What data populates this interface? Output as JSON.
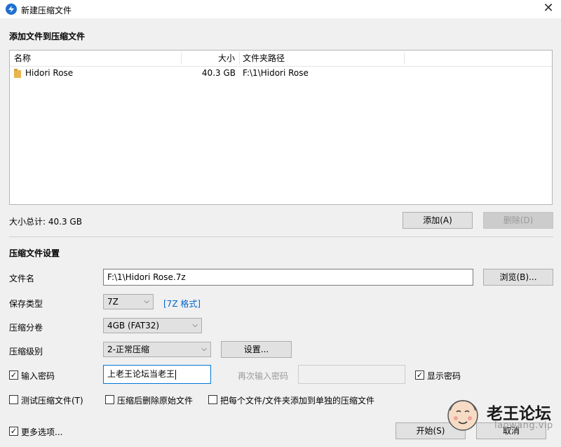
{
  "window": {
    "title": "新建压缩文件",
    "close_glyph": "✕"
  },
  "files_section": {
    "title": "添加文件到压缩文件",
    "columns": {
      "name": "名称",
      "size": "大小",
      "path": "文件夹路径"
    },
    "rows": [
      {
        "name": "Hidori Rose",
        "size": "40.3 GB",
        "path": "F:\\1\\Hidori Rose",
        "icon": "folder-icon"
      }
    ],
    "total": "大小总计: 40.3 GB",
    "add_label": "添加(A)",
    "remove_label": "删除(D)"
  },
  "settings": {
    "title": "压缩文件设置",
    "filename_label": "文件名",
    "filename_value": "F:\\1\\Hidori Rose.7z",
    "browse_label": "浏览(B)...",
    "type_label": "保存类型",
    "type_value": "7Z",
    "type_link": "[7Z 格式]",
    "split_label": "压缩分卷",
    "split_value": "4GB (FAT32)",
    "level_label": "压缩级别",
    "level_value": "2-正常压缩",
    "level_settings_label": "设置...",
    "password_label": "输入密码",
    "password_checked": true,
    "password_value": "上老王论坛当老王",
    "password_repeat_label": "再次输入密码",
    "show_password_label": "显示密码",
    "show_password_checked": true,
    "test_label": "测试压缩文件(T)",
    "delete_after_label": "压缩后删除原始文件",
    "each_file_label": "把每个文件/文件夹添加到单独的压缩文件"
  },
  "footer": {
    "more_options_label": "更多选项...",
    "more_options_checked": true,
    "start_label": "开始(S)",
    "cancel_label": "取消"
  },
  "watermark": {
    "text": "老王论坛",
    "url": "laowang.vip"
  },
  "colors": {
    "accent": "#0078d7",
    "link": "#0066cc",
    "folder": "#e8b64c"
  }
}
